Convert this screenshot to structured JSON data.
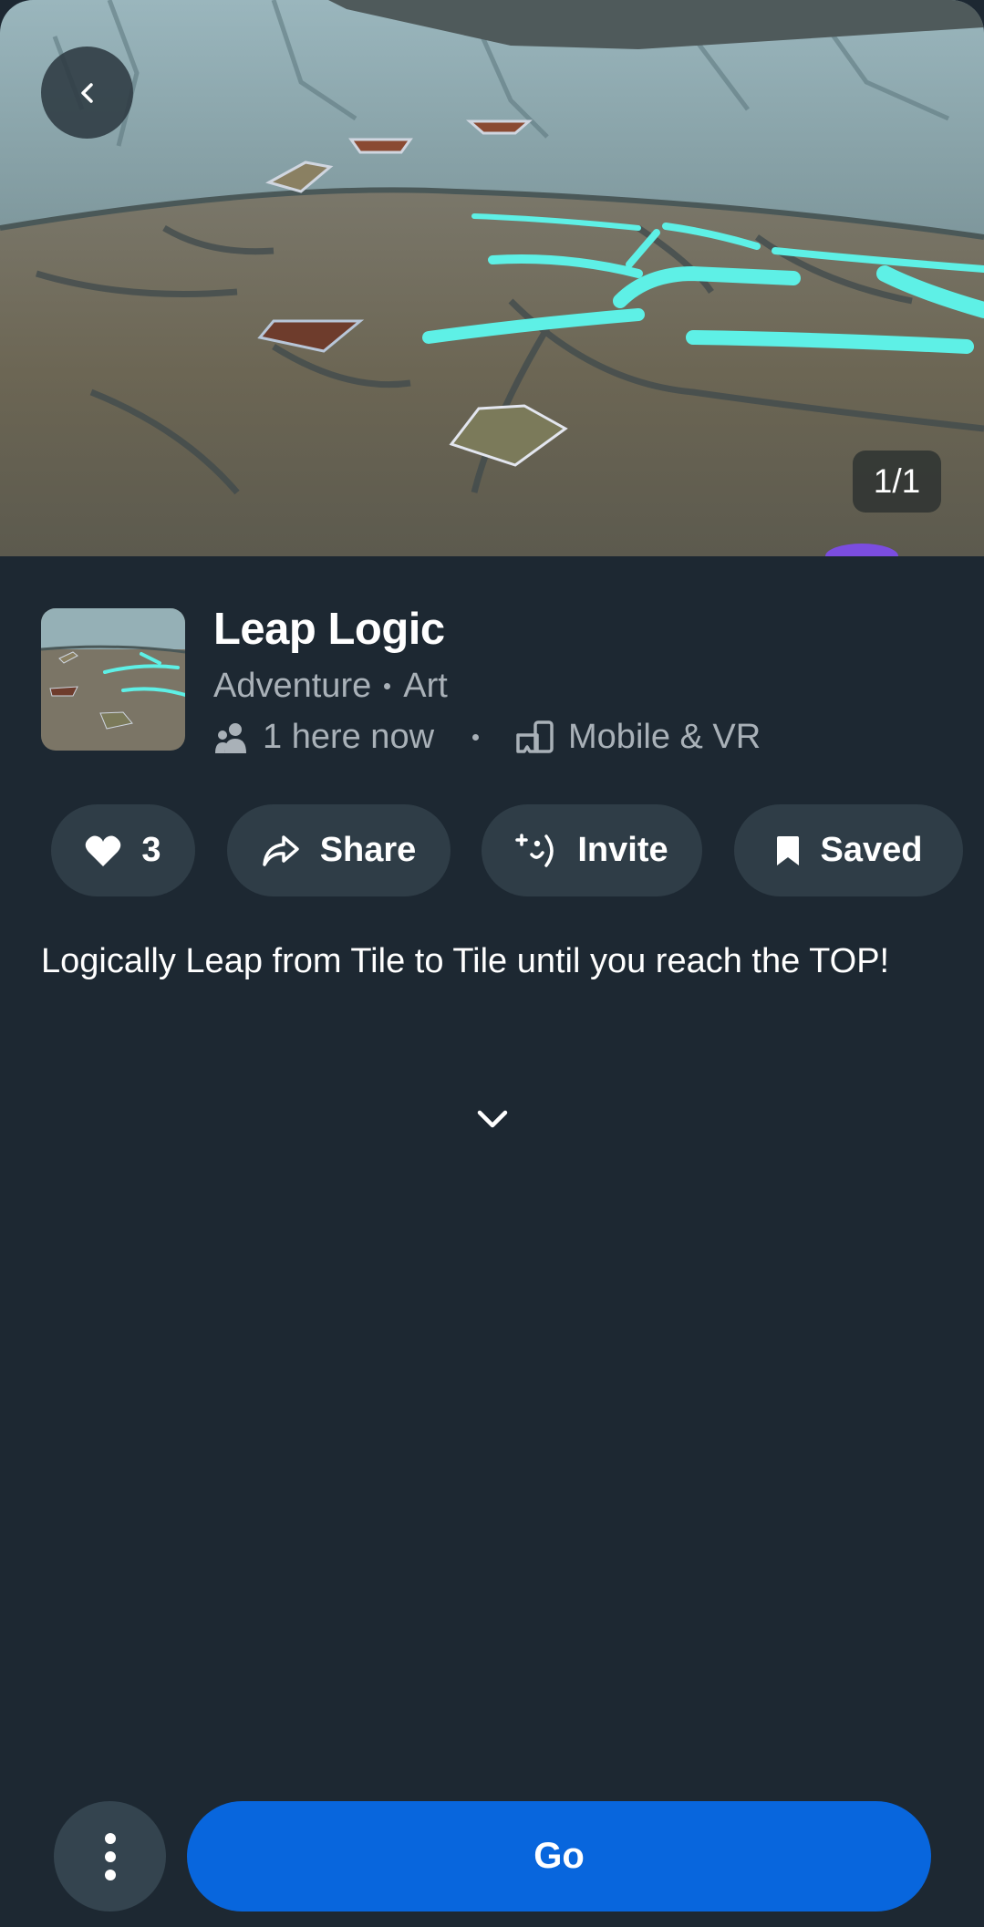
{
  "hero": {
    "image_label": "Leap Logic world screenshot",
    "counter": "1/1"
  },
  "world": {
    "title": "Leap Logic",
    "genres": [
      "Adventure",
      "Art"
    ],
    "presence": "1 here now",
    "platforms": "Mobile & VR"
  },
  "actions": {
    "likes_count": "3",
    "share_label": "Share",
    "invite_label": "Invite",
    "saved_label": "Saved"
  },
  "description": "Logically Leap from Tile to Tile until you reach the TOP!",
  "footer": {
    "go_label": "Go"
  },
  "colors": {
    "background": "#1d2832",
    "pill": "#2f3d47",
    "primary": "#0866dd",
    "muted_text": "#a9b1b8"
  }
}
